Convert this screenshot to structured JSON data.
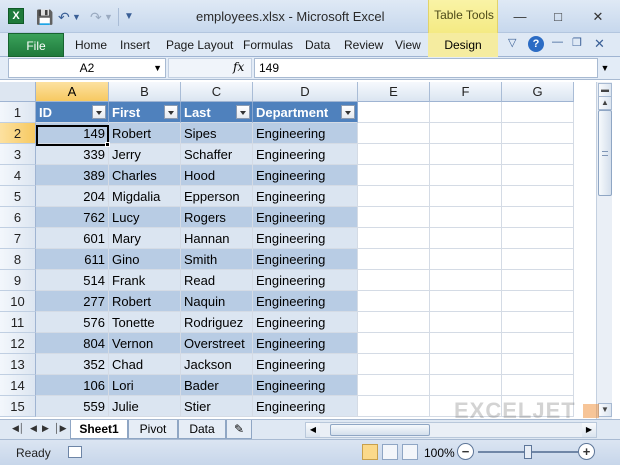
{
  "window": {
    "title": "employees.xlsx  -  Microsoft Excel",
    "table_tools_label": "Table Tools",
    "app_icon": "X"
  },
  "ribbon": {
    "file_tab": "File",
    "tabs": [
      "Home",
      "Insert",
      "Page Layout",
      "Formulas",
      "Data",
      "Review",
      "View"
    ],
    "design_tab": "Design"
  },
  "formula_bar": {
    "name_box": "A2",
    "fx": "fx",
    "value": "149"
  },
  "columns": [
    "A",
    "B",
    "C",
    "D",
    "E",
    "F",
    "G"
  ],
  "rows": [
    "1",
    "2",
    "3",
    "4",
    "5",
    "6",
    "7",
    "8",
    "9",
    "10",
    "11",
    "12",
    "13",
    "14",
    "15"
  ],
  "table": {
    "headers": [
      "ID",
      "First",
      "Last",
      "Department"
    ],
    "records": [
      [
        "149",
        "Robert",
        "Sipes",
        "Engineering"
      ],
      [
        "339",
        "Jerry",
        "Schaffer",
        "Engineering"
      ],
      [
        "389",
        "Charles",
        "Hood",
        "Engineering"
      ],
      [
        "204",
        "Migdalia",
        "Epperson",
        "Engineering"
      ],
      [
        "762",
        "Lucy",
        "Rogers",
        "Engineering"
      ],
      [
        "601",
        "Mary",
        "Hannan",
        "Engineering"
      ],
      [
        "611",
        "Gino",
        "Smith",
        "Engineering"
      ],
      [
        "514",
        "Frank",
        "Read",
        "Engineering"
      ],
      [
        "277",
        "Robert",
        "Naquin",
        "Engineering"
      ],
      [
        "576",
        "Tonette",
        "Rodriguez",
        "Engineering"
      ],
      [
        "804",
        "Vernon",
        "Overstreet",
        "Engineering"
      ],
      [
        "352",
        "Chad",
        "Jackson",
        "Engineering"
      ],
      [
        "106",
        "Lori",
        "Bader",
        "Engineering"
      ],
      [
        "559",
        "Julie",
        "Stier",
        "Engineering"
      ]
    ]
  },
  "sheets": [
    "Sheet1",
    "Pivot",
    "Data"
  ],
  "status": {
    "text": "Ready",
    "zoom": "100%"
  },
  "watermark": "EXCELJET",
  "colors": {
    "table_header": "#4f81bd",
    "band_light": "#dbe5f1",
    "band_dark": "#b8cce4",
    "file_tab": "#1f7a3c",
    "table_tools": "#f1e46a"
  }
}
